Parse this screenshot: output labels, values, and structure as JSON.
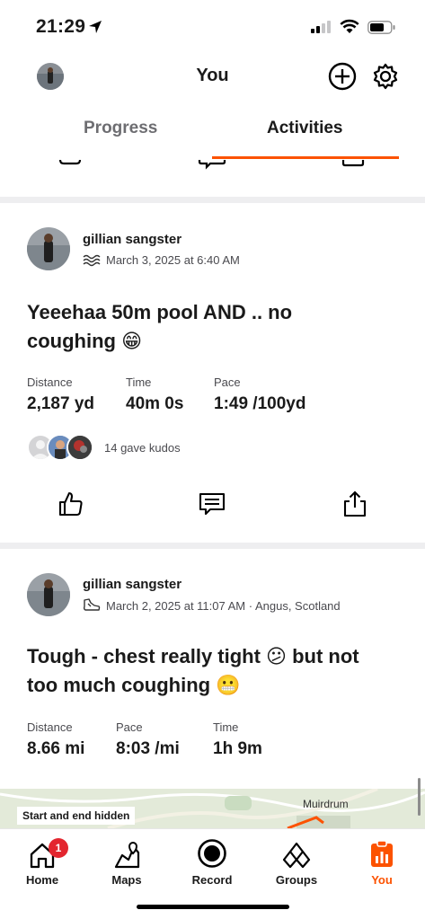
{
  "status_bar": {
    "time": "21:29"
  },
  "header": {
    "title": "You"
  },
  "tabs": [
    {
      "label": "Progress",
      "active": false
    },
    {
      "label": "Activities",
      "active": true
    }
  ],
  "activities": [
    {
      "athlete": "gillian sangster",
      "sport_icon": "swim-icon",
      "meta": "March 3, 2025 at 6:40 AM",
      "title_line1": "Yeeehaa 50m pool AND .. no",
      "title_line2": "coughing 😁",
      "stats": [
        {
          "label": "Distance",
          "value": "2,187 yd"
        },
        {
          "label": "Time",
          "value": "40m 0s"
        },
        {
          "label": "Pace",
          "value": "1:49 /100yd"
        }
      ],
      "kudos_text": "14 gave kudos"
    },
    {
      "athlete": "gillian sangster",
      "sport_icon": "run-shoe-icon",
      "meta": "March 2, 2025 at 11:07 AM · Angus, Scotland",
      "title_line1": "Tough - chest really tight 😕 but not",
      "title_line2": "too much coughing 😬",
      "stats": [
        {
          "label": "Distance",
          "value": "8.66 mi"
        },
        {
          "label": "Pace",
          "value": "8:03 /mi"
        },
        {
          "label": "Time",
          "value": "1h 9m"
        }
      ],
      "map_label": "Start and end hidden",
      "map_place": "Muirdrum"
    }
  ],
  "tabbar": {
    "items": [
      {
        "label": "Home",
        "icon": "home-icon",
        "badge": "1"
      },
      {
        "label": "Maps",
        "icon": "map-icon"
      },
      {
        "label": "Record",
        "icon": "record-icon"
      },
      {
        "label": "Groups",
        "icon": "groups-icon"
      },
      {
        "label": "You",
        "icon": "you-icon",
        "active": true
      }
    ]
  },
  "colors": {
    "accent": "#fc5200",
    "badge": "#e3262f",
    "divider": "#eeeef0"
  }
}
